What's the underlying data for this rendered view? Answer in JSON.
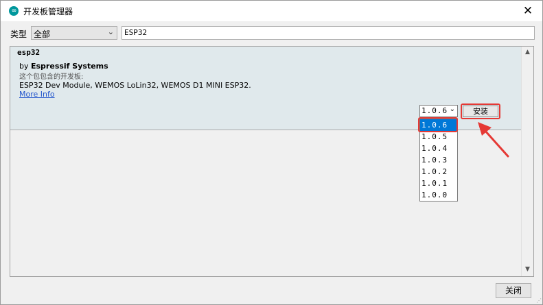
{
  "window": {
    "title": "开发板管理器",
    "close_glyph": "✕",
    "app_icon": "arduino-icon",
    "app_icon_glyph": "∞"
  },
  "filter": {
    "type_label": "类型",
    "type_value": "全部",
    "search_value": "ESP32"
  },
  "board": {
    "name": "esp32",
    "by_prefix": "by ",
    "author": "Espressif Systems",
    "contains_label": "这个包包含的开发板:",
    "boards_list": "ESP32 Dev Module, WEMOS LoLin32, WEMOS D1 MINI ESP32.",
    "more_info": "More Info",
    "selected_version": "1.0.6",
    "install_label": "安装"
  },
  "versions": [
    "1.0.6",
    "1.0.5",
    "1.0.4",
    "1.0.3",
    "1.0.2",
    "1.0.1",
    "1.0.0"
  ],
  "footer": {
    "close_label": "关闭"
  },
  "colors": {
    "highlight": "#e53935",
    "selection": "#0078d7",
    "item_bg": "#e0e9ec",
    "link": "#2255cc"
  }
}
